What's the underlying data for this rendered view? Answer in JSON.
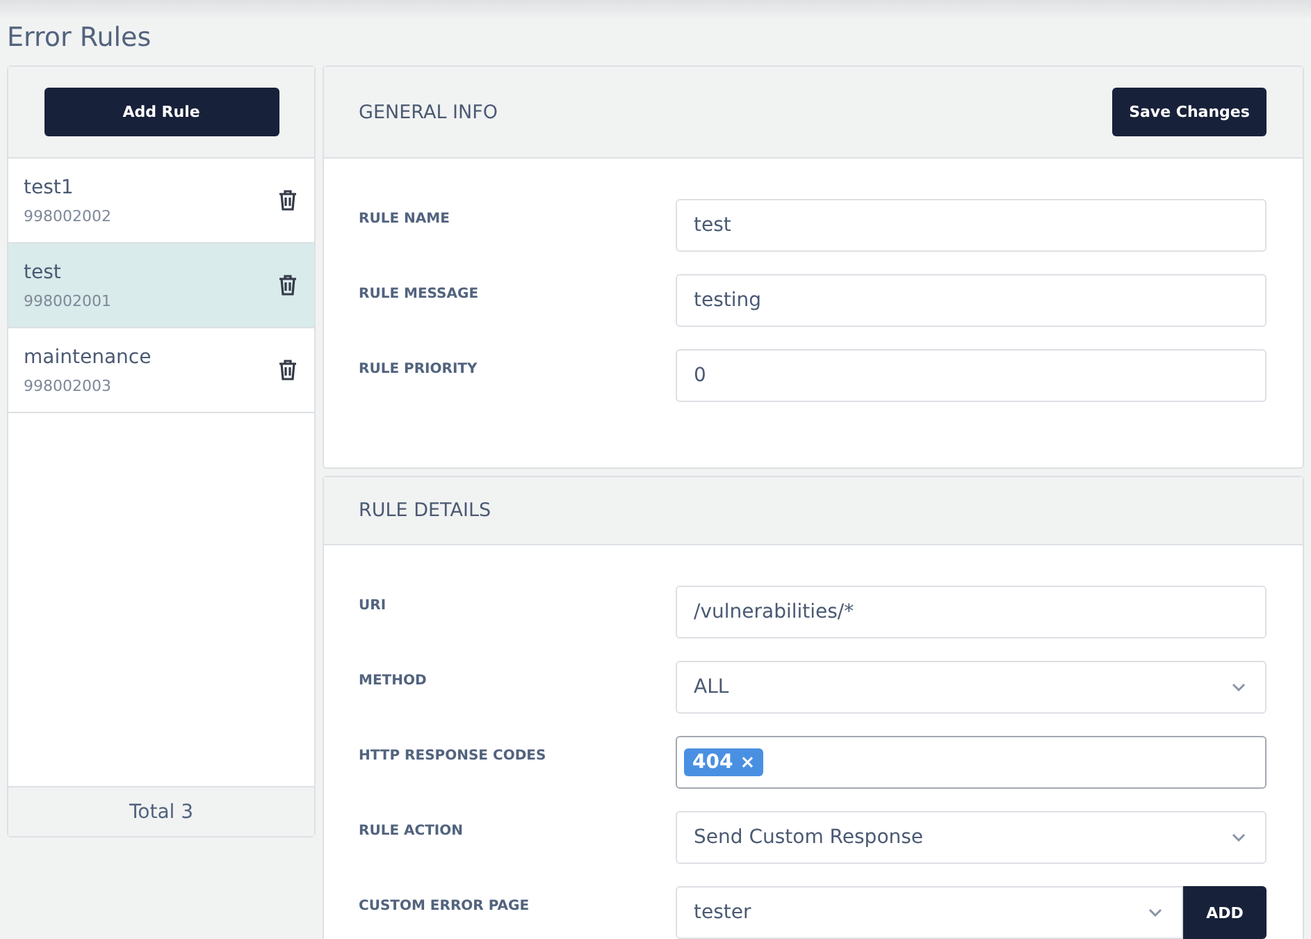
{
  "page_title": "Error Rules",
  "sidebar": {
    "add_button": "Add Rule",
    "items": [
      {
        "name": "test1",
        "code": "998002002",
        "selected": false
      },
      {
        "name": "test",
        "code": "998002001",
        "selected": true
      },
      {
        "name": "maintenance",
        "code": "998002003",
        "selected": false
      }
    ],
    "total": "Total 3"
  },
  "general_info": {
    "title": "GENERAL INFO",
    "save_button": "Save Changes",
    "fields": [
      {
        "label": "RULE NAME",
        "value": "test"
      },
      {
        "label": "RULE MESSAGE",
        "value": "testing"
      },
      {
        "label": "RULE PRIORITY",
        "value": "0"
      }
    ]
  },
  "rule_details": {
    "title": "RULE DETAILS",
    "fields": [
      {
        "kind": "text",
        "label": "URI",
        "value": "/vulnerabilities/*"
      },
      {
        "kind": "select",
        "label": "METHOD",
        "value": "ALL"
      },
      {
        "kind": "tags",
        "label": "HTTP RESPONSE CODES",
        "tags": [
          {
            "text": "404",
            "remove": "×"
          }
        ]
      },
      {
        "kind": "select",
        "label": "RULE ACTION",
        "value": "Send Custom Response"
      },
      {
        "kind": "select_button",
        "label": "CUSTOM ERROR PAGE",
        "value": "tester",
        "button": "ADD"
      }
    ]
  }
}
